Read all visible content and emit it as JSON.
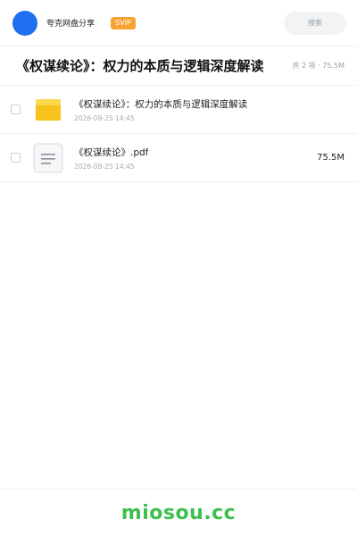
{
  "header": {
    "brand": "夸克网盘分享",
    "badge": "SVIP",
    "search_label": "搜索"
  },
  "folder": {
    "title": "《权谋续论》：权力的本质与逻辑深度解读",
    "meta": "共 2 项 · 75.5M"
  },
  "files": [
    {
      "name": "《权谋续论》：权力的本质与逻辑深度解读",
      "date": "2026-08-25 14:45",
      "size": "",
      "icon": "folder-icon"
    },
    {
      "name": "《权谋续论》.pdf",
      "date": "2026-08-25 14:45",
      "size": "75.5M",
      "icon": "document-icon"
    }
  ],
  "footer": {
    "watermark": "miosou.cc"
  },
  "colors": {
    "avatar": "#1f6ff2",
    "badge": "#f7a334",
    "folder": "#f9c21b",
    "watermark": "#3cbf4f"
  }
}
